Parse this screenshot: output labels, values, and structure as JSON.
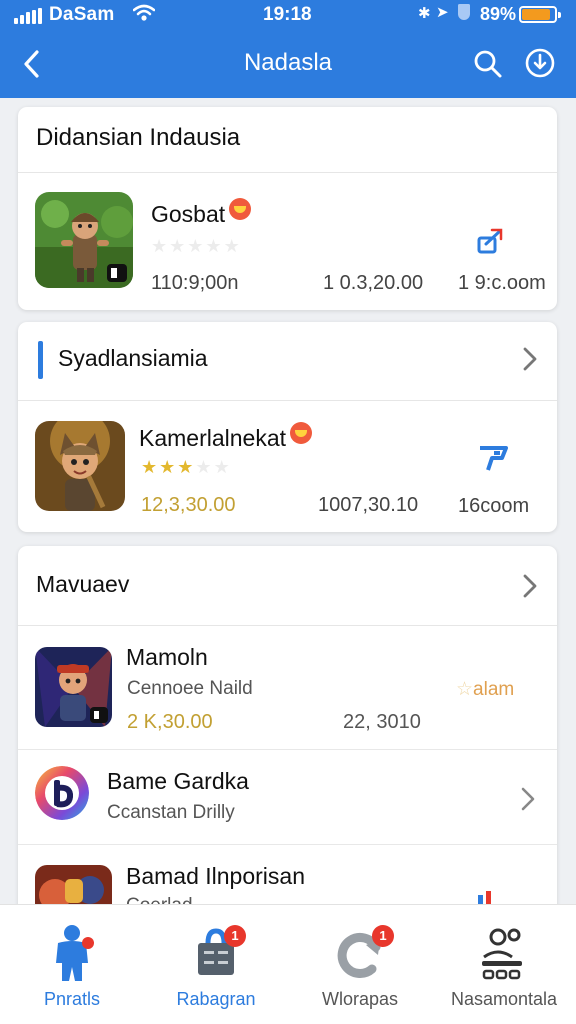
{
  "status_bar": {
    "carrier": "DaSam",
    "time": "19:18",
    "battery_text": "89%",
    "battery_level": 0.89,
    "battery_color": "#f39a1e"
  },
  "header": {
    "title": "Nadasla",
    "background": "#2d7cde",
    "back_icon": "chevron-left-icon",
    "search_icon": "search-icon",
    "download_icon": "download-circle-icon"
  },
  "section1": {
    "title": "Didansian Indausia",
    "app": {
      "name": "Gosbat",
      "rating": 0,
      "col1": "110:9;00n",
      "col2": "1 0.3,20.00",
      "col3": "1 9:c.oom",
      "action_icon": "share-icon"
    }
  },
  "section2": {
    "title": "Syadlansiamia",
    "app": {
      "name": "Kamerlalnekat",
      "rating": 3,
      "col1": "12,3,30.00",
      "col2": "1007,30.10",
      "col3": "16coom",
      "action_icon": "flag-icon"
    }
  },
  "section3": {
    "title": "Mavuaev",
    "apps": [
      {
        "name": "Mamoln",
        "sub": "Cennoee Naild",
        "col1": "2 K,30.00",
        "col2": "22, 3010",
        "tag": "alam",
        "tag_icon": "star-icon"
      },
      {
        "name": "Bame Gardka",
        "sub": "Ccanstan Drilly"
      },
      {
        "name": "Bamad Ilnporisan",
        "sub": "Coerlad"
      }
    ]
  },
  "tabbar": {
    "tabs": [
      {
        "label": "Pnratls",
        "icon": "person-icon",
        "active": true
      },
      {
        "label": "Rabagran",
        "icon": "briefcase-icon",
        "badge": "1",
        "active": false
      },
      {
        "label": "Wlorapas",
        "icon": "refresh-icon",
        "badge": "1",
        "active": false
      },
      {
        "label": "Nasamontala",
        "icon": "user-group-icon",
        "active": false
      }
    ]
  }
}
